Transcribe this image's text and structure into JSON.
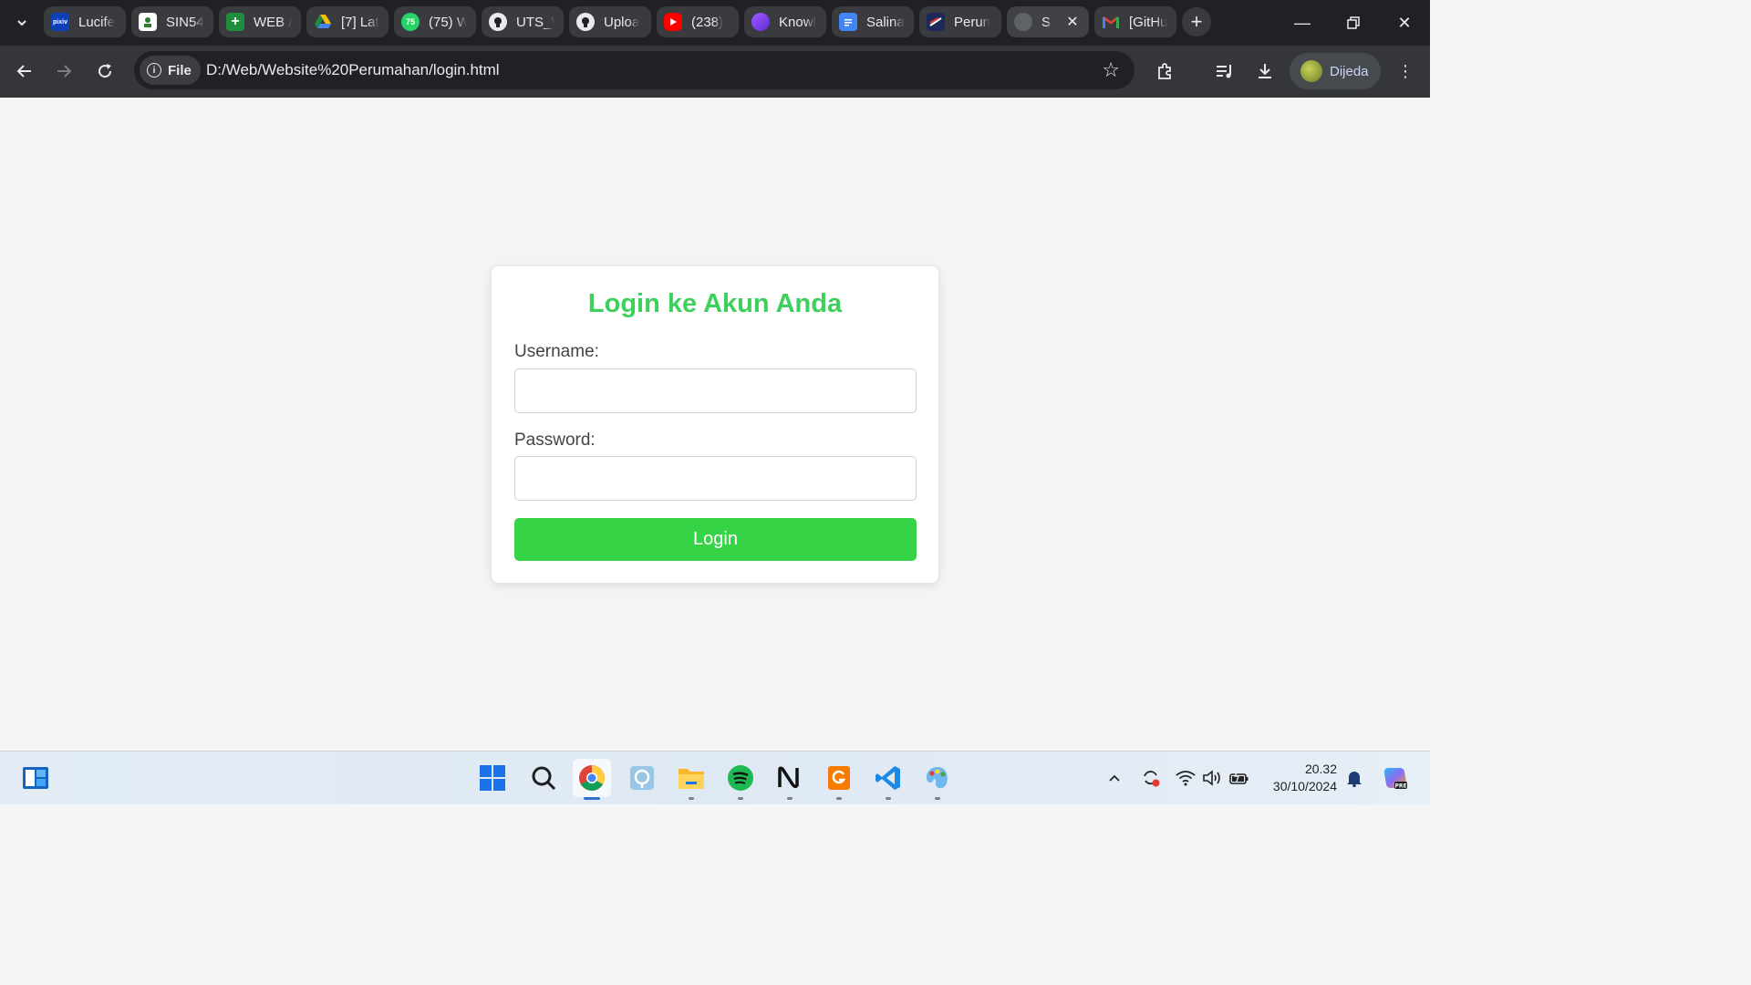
{
  "browser": {
    "tabs": [
      {
        "label": "Lucife",
        "icon": "pixiv-icon",
        "color": "#0f3fb6"
      },
      {
        "label": "SIN54",
        "icon": "campus-logo-icon",
        "color": "#2e7d32"
      },
      {
        "label": "WEB /",
        "icon": "google-sheets-icon",
        "color": "#1e8e3e"
      },
      {
        "label": "[7] Lat",
        "icon": "google-drive-icon",
        "color": "#fbbc04"
      },
      {
        "label": "(75) W",
        "icon": "whatsapp-icon",
        "color": "#25d366"
      },
      {
        "label": "UTS_V",
        "icon": "github-icon",
        "color": "#e8eaed"
      },
      {
        "label": "Uploa",
        "icon": "github-icon",
        "color": "#e8eaed"
      },
      {
        "label": "(238)",
        "icon": "youtube-icon",
        "color": "#ff0000"
      },
      {
        "label": "Knowl",
        "icon": "knowledge-icon",
        "color": "#7b3fe4"
      },
      {
        "label": "Salina",
        "icon": "google-docs-icon",
        "color": "#4285f4"
      },
      {
        "label": "Perun",
        "icon": "perumahan-icon",
        "color": "#c62828"
      },
      {
        "label": "S",
        "icon": "globe-icon",
        "color": "#6d6f73",
        "active": true
      },
      {
        "label": "[GitHu",
        "icon": "gmail-icon",
        "color": "#ea4335"
      }
    ],
    "site_chip_label": "File",
    "url": "D:/Web/Website%20Perumahan/login.html",
    "profile_label": "Dijeda"
  },
  "page": {
    "title": "Login ke Akun Anda",
    "username_label": "Username:",
    "username_value": "",
    "password_label": "Password:",
    "password_value": "",
    "login_button": "Login",
    "accent_color": "#3fcf5c",
    "button_color": "#37d347"
  },
  "taskbar": {
    "apps": [
      "start-icon",
      "search-icon",
      "chrome-icon",
      "photos-icon",
      "file-explorer-icon",
      "spotify-icon",
      "notion-icon",
      "pdf-editor-icon",
      "vscode-icon",
      "paint-icon"
    ],
    "clock_time": "20.32",
    "clock_date": "30/10/2024"
  }
}
